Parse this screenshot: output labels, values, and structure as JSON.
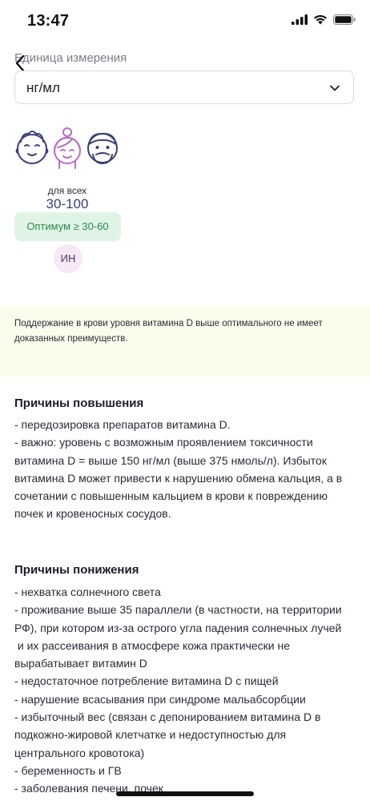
{
  "status_bar": {
    "time": "13:47"
  },
  "header": {
    "back_icon": "chevron-left-icon"
  },
  "unit": {
    "label": "Единица измерения",
    "value": "нг/мл",
    "chevron_icon": "chevron-down-icon"
  },
  "reference": {
    "group_label": "для всех",
    "range": "30-100",
    "optimum": "Оптимум ≥ 30-60",
    "badge": "ИН",
    "avatar_icons": [
      "baby-icon",
      "woman-icon",
      "man-icon"
    ]
  },
  "note": {
    "lines": [
      "Поддержание в крови уровня витамина D выше оптимального не имеет",
      "доказанных преимуществ."
    ]
  },
  "increase": {
    "title": "Причины повышения",
    "lines": [
      "- передозировка препаратов витамина D.",
      "- важно: уровень с возможным проявлением токсичности",
      "витамина D = выше 150 нг/мл (выше 375 нмоль/л). Избыток",
      "витамина D может привести к нарушению обмена кальция, а в",
      "сочетании с повышенным кальцием в крови к повреждению",
      "почек и кровеносных сосудов."
    ]
  },
  "decrease": {
    "title": "Причины понижения",
    "lines": [
      "- нехватка солнечного света",
      "- проживание выше 35 параллели (в частности, на территории",
      "РФ), при котором из-за острого угла падения солнечных лучей",
      " и их рассеивания в атмосфере кожа практически не",
      "вырабатывает витамин D",
      "- недостаточное потребление витамина D с пищей",
      "- нарушение всасывания при синдроме мальабсорбции",
      "- избыточный вес (связан с депонированием витамина D в",
      "подкожно-жировой клетчатке и недоступностью для",
      "центрального кровотока)",
      "- беременность и ГВ",
      "- заболевания печени, почек"
    ]
  },
  "colors": {
    "accent": "#3a3f78",
    "optimum_bg": "#dff4e6",
    "optimum_text": "#2f8a4e",
    "note_bg": "#fcfcec",
    "badge_bg": "#f7e8f5",
    "woman_icon": "#b86bc8"
  }
}
